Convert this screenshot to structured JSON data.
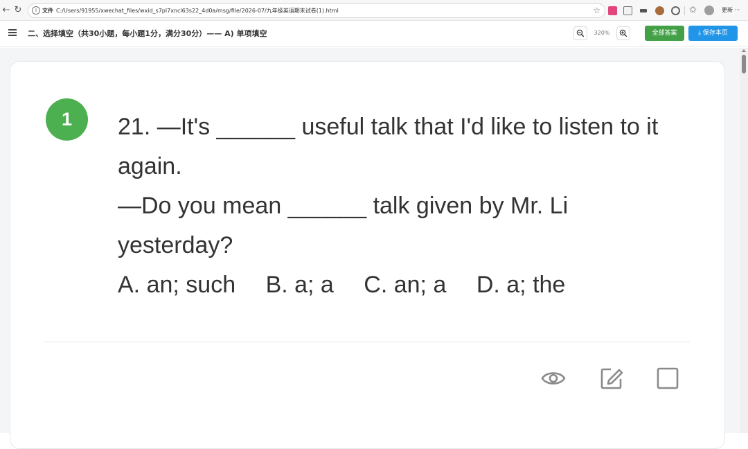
{
  "browser": {
    "protocol_label": "文件",
    "url": "C:/Users/91955/xwechat_files/wxid_s7pl7xncl63s22_4d0a/msg/file/2026-07/九年级英语期末试卷(1).html",
    "update_label": "更新 ···"
  },
  "toolbar": {
    "section_title": "二、选择填空（共30小题，每小题1分，满分30分）—— A) 单项填空",
    "zoom_level": "320%",
    "zoom_out_icon": "−",
    "zoom_in_icon": "+",
    "show_all_answers_label": "全部答案",
    "save_page_label": "⤓ 保存本页"
  },
  "question": {
    "badge": "1",
    "lines": [
      "21. —It's ______ useful talk that I'd like to listen to it",
      "again.",
      "—Do you mean ______ talk given by Mr. Li",
      "yesterday?"
    ],
    "options": [
      "A. an; such",
      "B. a; a",
      "C. an; a",
      "D. a; the"
    ]
  },
  "colors": {
    "badge": "#4caf50",
    "show_answers_button": "#43a047",
    "save_button": "#2196e8",
    "icon_gray": "#8a8a8a"
  },
  "icons": {
    "reveal": "eye-icon",
    "edit": "edit-icon",
    "mark": "checkbox-icon"
  }
}
